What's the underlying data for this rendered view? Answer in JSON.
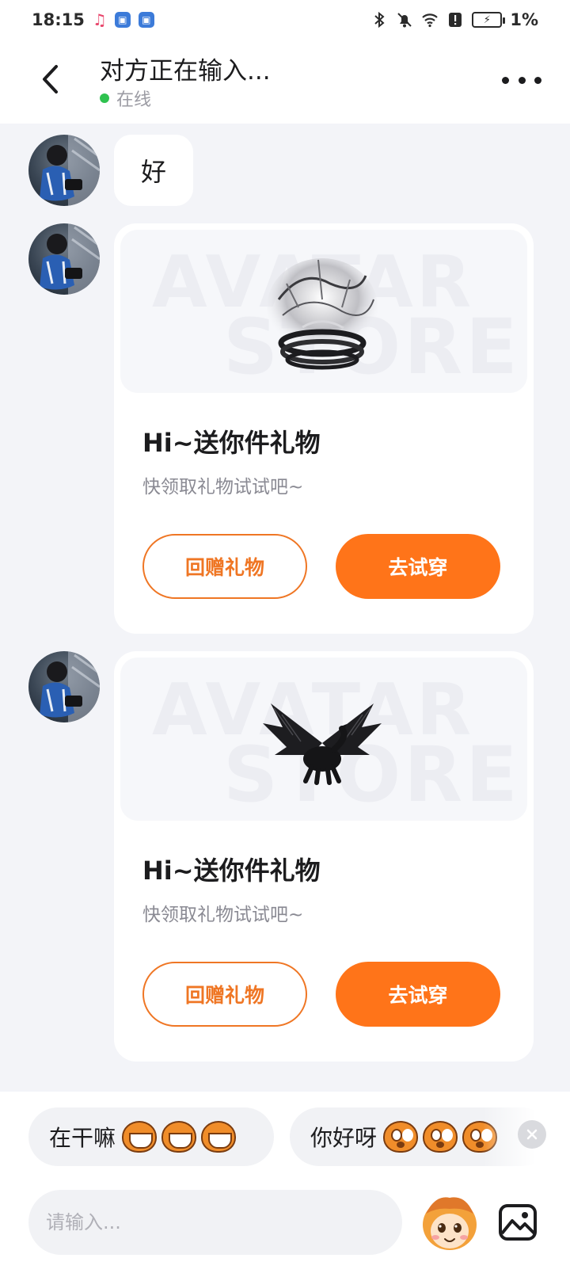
{
  "status_bar": {
    "time": "18:15",
    "battery_percent": "1%"
  },
  "header": {
    "title": "对方正在输入...",
    "online_status": "在线"
  },
  "messages": [
    {
      "type": "text",
      "text": "好"
    },
    {
      "type": "gift",
      "banner_watermark_top": "AVATAR",
      "banner_watermark_bottom": "STORE",
      "gift_item": "dragon-ring",
      "title": "Hi~送你件礼物",
      "subtitle": "快领取礼物试试吧~",
      "return_gift_label": "回赠礼物",
      "try_on_label": "去试穿"
    },
    {
      "type": "gift",
      "banner_watermark_top": "AVATAR",
      "banner_watermark_bottom": "STORE",
      "gift_item": "black-dragon",
      "title": "Hi~送你件礼物",
      "subtitle": "快领取礼物试试吧~",
      "return_gift_label": "回赠礼物",
      "try_on_label": "去试穿"
    }
  ],
  "quick_replies": [
    {
      "text": "在干嘛",
      "emoji": "grinning-mascot"
    },
    {
      "text": "你好呀",
      "emoji": "surprised-mascot"
    }
  ],
  "input": {
    "placeholder": "请输入..."
  },
  "colors": {
    "accent": "#ff7419",
    "online": "#2fc24f",
    "background": "#f3f4f8"
  }
}
